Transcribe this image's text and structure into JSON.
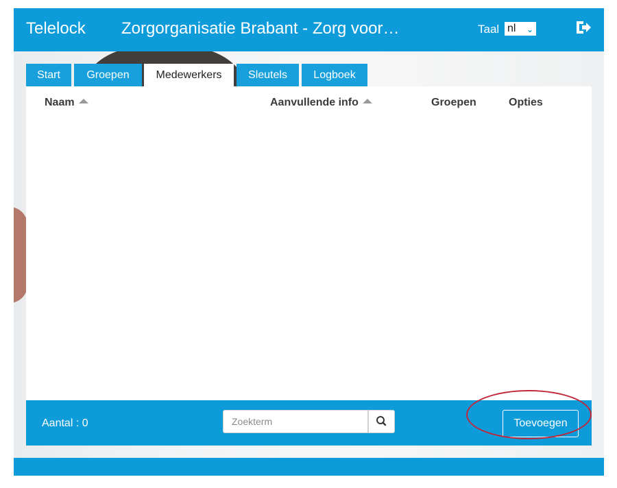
{
  "header": {
    "brand": "Telelock",
    "org_title": "Zorgorganisatie Brabant - Zorg voor…",
    "language_label": "Taal",
    "language_value": "nl",
    "logout_icon": "sign-out-icon"
  },
  "tabs": [
    {
      "label": "Start",
      "active": false
    },
    {
      "label": "Groepen",
      "active": false
    },
    {
      "label": "Medewerkers",
      "active": true
    },
    {
      "label": "Sleutels",
      "active": false
    },
    {
      "label": "Logboek",
      "active": false
    }
  ],
  "table": {
    "columns": [
      {
        "label": "Naam",
        "sortable": true
      },
      {
        "label": "Aanvullende info",
        "sortable": true
      },
      {
        "label": "Groepen",
        "sortable": false
      },
      {
        "label": "Opties",
        "sortable": false
      }
    ],
    "rows": []
  },
  "footer": {
    "count_text": "Aantal : 0",
    "search_placeholder": "Zoekterm",
    "search_icon": "search-icon",
    "add_label": "Toevoegen"
  },
  "colors": {
    "accent": "#0d9bda",
    "annotation": "#c0283a"
  }
}
